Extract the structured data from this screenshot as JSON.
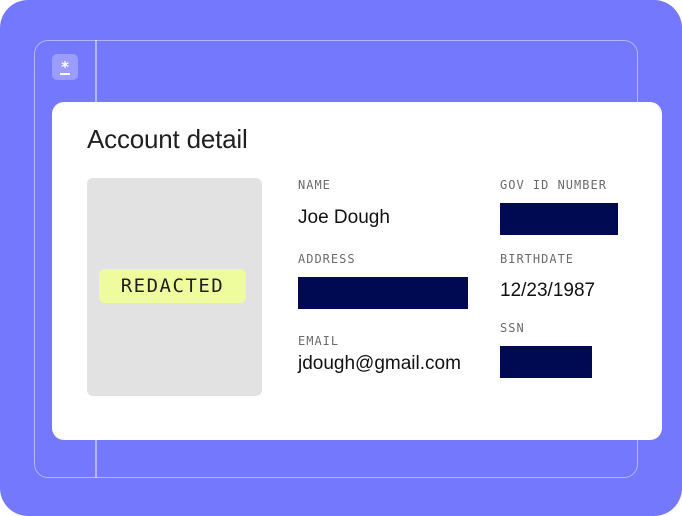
{
  "app": {
    "icon_name": "asterisk-icon",
    "icon_glyph": "*"
  },
  "card": {
    "title": "Account detail",
    "photo": {
      "badge_text": "REDACTED",
      "badge_color": "#eefc9e",
      "placeholder_color": "#e2e2e2"
    },
    "fields": {
      "name": {
        "label": "NAME",
        "value": "Joe Dough"
      },
      "address": {
        "label": "ADDRESS",
        "redacted": true
      },
      "email": {
        "label": "EMAIL",
        "value": "jdough@gmail.com"
      },
      "gov_id": {
        "label": "GOV ID NUMBER",
        "redacted": true
      },
      "birthdate": {
        "label": "BIRTHDATE",
        "value": "12/23/1987"
      },
      "ssn": {
        "label": "SSN",
        "redacted": true
      }
    }
  },
  "colors": {
    "background": "#7478fc",
    "card": "#ffffff",
    "redaction": "#000a52"
  }
}
